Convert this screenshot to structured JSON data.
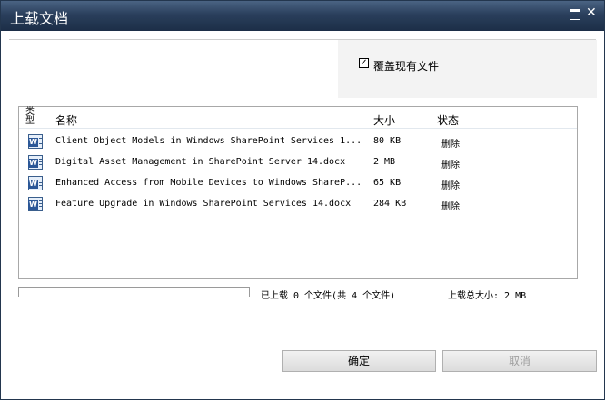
{
  "window": {
    "title": "上载文档"
  },
  "options": {
    "overwrite_label": "覆盖现有文件",
    "overwrite_checked_glyph": "✓"
  },
  "list": {
    "headers": {
      "type": "类型",
      "name": "名称",
      "size": "大小",
      "status": "状态"
    },
    "rows": [
      {
        "icon": "word-document-icon",
        "name": "Client Object Models in Windows SharePoint Services 1...",
        "size": "80 KB",
        "status": "删除"
      },
      {
        "icon": "word-document-icon",
        "name": "Digital Asset Management in SharePoint Server 14.docx",
        "size": "2 MB",
        "status": "删除"
      },
      {
        "icon": "word-document-icon",
        "name": "Enhanced Access from Mobile Devices to Windows ShareP...",
        "size": "65 KB",
        "status": "删除"
      },
      {
        "icon": "word-document-icon",
        "name": "Feature Upgrade in Windows SharePoint Services 14.docx",
        "size": "284 KB",
        "status": "删除"
      }
    ]
  },
  "progress": {
    "fraction": 0,
    "status_text": "已上载 0 个文件(共 4 个文件)",
    "total_text": "上载总大小: 2 MB"
  },
  "buttons": {
    "ok": "确定",
    "cancel": "取消"
  },
  "icons": {
    "doc_letter": "W"
  }
}
